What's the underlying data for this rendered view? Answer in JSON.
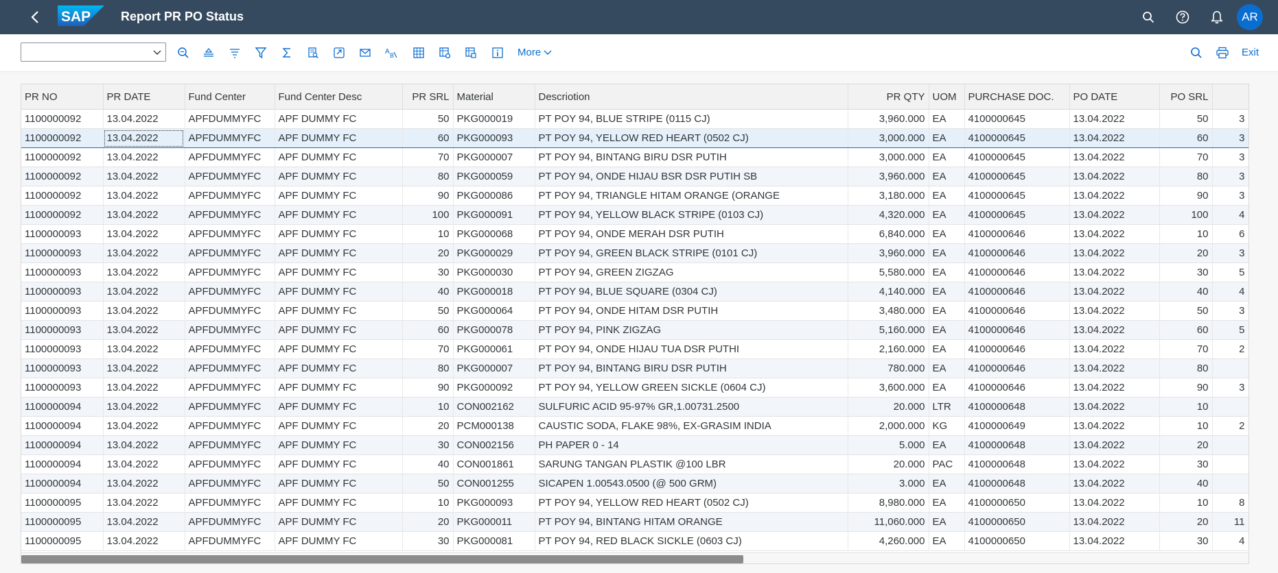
{
  "shell": {
    "logo_text": "SAP",
    "title": "Report PR PO Status",
    "avatar_initials": "AR",
    "colors": {
      "header_bg": "#354a5f",
      "accent": "#0a6ed1"
    }
  },
  "toolbar": {
    "dropdown_value": "",
    "icons": [
      "find-icon",
      "sort-ascending-icon",
      "sort-descending-icon",
      "filter-icon",
      "sum-icon",
      "print-preview-icon",
      "export-icon",
      "send-mail-icon",
      "abc-analysis-icon",
      "layout-grid-icon",
      "layout-settings-icon",
      "layout-select-icon",
      "details-icon"
    ],
    "more_label": "More",
    "exit_label": "Exit"
  },
  "table": {
    "columns": [
      "PR NO",
      "PR DATE",
      "Fund Center",
      "Fund Center Desc",
      "PR SRL",
      "Material",
      "Descriotion",
      "PR QTY",
      "UOM",
      "PURCHASE DOC.",
      "PO DATE",
      "PO SRL",
      ""
    ],
    "rows": [
      [
        "1100000092",
        "13.04.2022",
        "APFDUMMYFC",
        "APF DUMMY FC",
        "50",
        "PKG000019",
        "PT POY 94, BLUE STRIPE (0115 CJ)",
        "3,960.000",
        "EA",
        "4100000645",
        "13.04.2022",
        "50",
        "3"
      ],
      [
        "1100000092",
        "13.04.2022",
        "APFDUMMYFC",
        "APF DUMMY FC",
        "60",
        "PKG000093",
        "PT POY 94, YELLOW RED HEART (0502 CJ)",
        "3,000.000",
        "EA",
        "4100000645",
        "13.04.2022",
        "60",
        "3"
      ],
      [
        "1100000092",
        "13.04.2022",
        "APFDUMMYFC",
        "APF DUMMY FC",
        "70",
        "PKG000007",
        "PT POY 94, BINTANG BIRU DSR PUTIH",
        "3,000.000",
        "EA",
        "4100000645",
        "13.04.2022",
        "70",
        "3"
      ],
      [
        "1100000092",
        "13.04.2022",
        "APFDUMMYFC",
        "APF DUMMY FC",
        "80",
        "PKG000059",
        "PT POY 94, ONDE HIJAU BSR DSR PUTIH SB",
        "3,960.000",
        "EA",
        "4100000645",
        "13.04.2022",
        "80",
        "3"
      ],
      [
        "1100000092",
        "13.04.2022",
        "APFDUMMYFC",
        "APF DUMMY FC",
        "90",
        "PKG000086",
        "PT POY 94, TRIANGLE HITAM ORANGE (ORANGE",
        "3,180.000",
        "EA",
        "4100000645",
        "13.04.2022",
        "90",
        "3"
      ],
      [
        "1100000092",
        "13.04.2022",
        "APFDUMMYFC",
        "APF DUMMY FC",
        "100",
        "PKG000091",
        "PT POY 94, YELLOW BLACK STRIPE (0103 CJ)",
        "4,320.000",
        "EA",
        "4100000645",
        "13.04.2022",
        "100",
        "4"
      ],
      [
        "1100000093",
        "13.04.2022",
        "APFDUMMYFC",
        "APF DUMMY FC",
        "10",
        "PKG000068",
        "PT POY 94, ONDE MERAH DSR PUTIH",
        "6,840.000",
        "EA",
        "4100000646",
        "13.04.2022",
        "10",
        "6"
      ],
      [
        "1100000093",
        "13.04.2022",
        "APFDUMMYFC",
        "APF DUMMY FC",
        "20",
        "PKG000029",
        "PT POY 94, GREEN BLACK STRIPE (0101 CJ)",
        "3,960.000",
        "EA",
        "4100000646",
        "13.04.2022",
        "20",
        "3"
      ],
      [
        "1100000093",
        "13.04.2022",
        "APFDUMMYFC",
        "APF DUMMY FC",
        "30",
        "PKG000030",
        "PT POY 94, GREEN ZIGZAG",
        "5,580.000",
        "EA",
        "4100000646",
        "13.04.2022",
        "30",
        "5"
      ],
      [
        "1100000093",
        "13.04.2022",
        "APFDUMMYFC",
        "APF DUMMY FC",
        "40",
        "PKG000018",
        "PT POY 94, BLUE SQUARE (0304 CJ)",
        "4,140.000",
        "EA",
        "4100000646",
        "13.04.2022",
        "40",
        "4"
      ],
      [
        "1100000093",
        "13.04.2022",
        "APFDUMMYFC",
        "APF DUMMY FC",
        "50",
        "PKG000064",
        "PT POY 94, ONDE HITAM DSR PUTIH",
        "3,480.000",
        "EA",
        "4100000646",
        "13.04.2022",
        "50",
        "3"
      ],
      [
        "1100000093",
        "13.04.2022",
        "APFDUMMYFC",
        "APF DUMMY FC",
        "60",
        "PKG000078",
        "PT POY 94, PINK ZIGZAG",
        "5,160.000",
        "EA",
        "4100000646",
        "13.04.2022",
        "60",
        "5"
      ],
      [
        "1100000093",
        "13.04.2022",
        "APFDUMMYFC",
        "APF DUMMY FC",
        "70",
        "PKG000061",
        "PT POY 94, ONDE HIJAU TUA DSR PUTHI",
        "2,160.000",
        "EA",
        "4100000646",
        "13.04.2022",
        "70",
        "2"
      ],
      [
        "1100000093",
        "13.04.2022",
        "APFDUMMYFC",
        "APF DUMMY FC",
        "80",
        "PKG000007",
        "PT POY 94, BINTANG BIRU DSR PUTIH",
        "780.000",
        "EA",
        "4100000646",
        "13.04.2022",
        "80",
        ""
      ],
      [
        "1100000093",
        "13.04.2022",
        "APFDUMMYFC",
        "APF DUMMY FC",
        "90",
        "PKG000092",
        "PT POY 94, YELLOW GREEN SICKLE (0604 CJ)",
        "3,600.000",
        "EA",
        "4100000646",
        "13.04.2022",
        "90",
        "3"
      ],
      [
        "1100000094",
        "13.04.2022",
        "APFDUMMYFC",
        "APF DUMMY FC",
        "10",
        "CON002162",
        "SULFURIC ACID 95-97% GR,1.00731.2500",
        "20.000",
        "LTR",
        "4100000648",
        "13.04.2022",
        "10",
        ""
      ],
      [
        "1100000094",
        "13.04.2022",
        "APFDUMMYFC",
        "APF DUMMY FC",
        "20",
        "PCM000138",
        "CAUSTIC SODA, FLAKE 98%, EX-GRASIM INDIA",
        "2,000.000",
        "KG",
        "4100000649",
        "13.04.2022",
        "10",
        "2"
      ],
      [
        "1100000094",
        "13.04.2022",
        "APFDUMMYFC",
        "APF DUMMY FC",
        "30",
        "CON002156",
        "PH PAPER 0 - 14",
        "5.000",
        "EA",
        "4100000648",
        "13.04.2022",
        "20",
        ""
      ],
      [
        "1100000094",
        "13.04.2022",
        "APFDUMMYFC",
        "APF DUMMY FC",
        "40",
        "CON001861",
        "SARUNG TANGAN PLASTIK @100 LBR",
        "20.000",
        "PAC",
        "4100000648",
        "13.04.2022",
        "30",
        ""
      ],
      [
        "1100000094",
        "13.04.2022",
        "APFDUMMYFC",
        "APF DUMMY FC",
        "50",
        "CON001255",
        "SICAPEN 1.00543.0500 (@ 500 GRM)",
        "3.000",
        "EA",
        "4100000648",
        "13.04.2022",
        "40",
        ""
      ],
      [
        "1100000095",
        "13.04.2022",
        "APFDUMMYFC",
        "APF DUMMY FC",
        "10",
        "PKG000093",
        "PT POY 94, YELLOW RED HEART (0502 CJ)",
        "8,980.000",
        "EA",
        "4100000650",
        "13.04.2022",
        "10",
        "8"
      ],
      [
        "1100000095",
        "13.04.2022",
        "APFDUMMYFC",
        "APF DUMMY FC",
        "20",
        "PKG000011",
        "PT POY 94, BINTANG HITAM ORANGE",
        "11,060.000",
        "EA",
        "4100000650",
        "13.04.2022",
        "20",
        "11"
      ],
      [
        "1100000095",
        "13.04.2022",
        "APFDUMMYFC",
        "APF DUMMY FC",
        "30",
        "PKG000081",
        "PT POY 94, RED BLACK SICKLE (0603 CJ)",
        "4,260.000",
        "EA",
        "4100000650",
        "13.04.2022",
        "30",
        "4"
      ]
    ],
    "selected_row": 1
  }
}
